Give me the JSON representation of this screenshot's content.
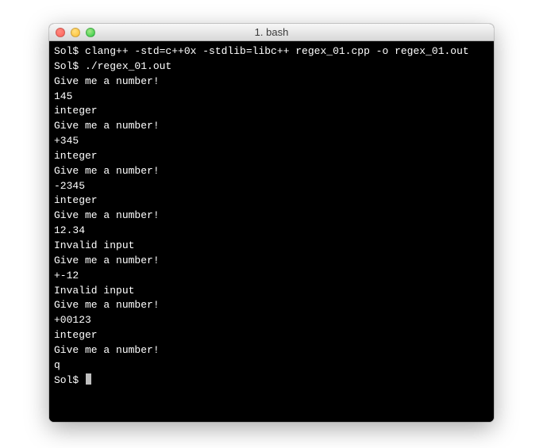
{
  "window": {
    "title": "1. bash"
  },
  "prompt": "Sol$ ",
  "lines": [
    {
      "type": "cmd",
      "text": "clang++ -std=c++0x -stdlib=libc++ regex_01.cpp -o regex_01.out"
    },
    {
      "type": "cmd",
      "text": "./regex_01.out"
    },
    {
      "type": "out",
      "text": "Give me a number!"
    },
    {
      "type": "out",
      "text": "145"
    },
    {
      "type": "out",
      "text": "integer"
    },
    {
      "type": "out",
      "text": "Give me a number!"
    },
    {
      "type": "out",
      "text": "+345"
    },
    {
      "type": "out",
      "text": "integer"
    },
    {
      "type": "out",
      "text": "Give me a number!"
    },
    {
      "type": "out",
      "text": "-2345"
    },
    {
      "type": "out",
      "text": "integer"
    },
    {
      "type": "out",
      "text": "Give me a number!"
    },
    {
      "type": "out",
      "text": "12.34"
    },
    {
      "type": "out",
      "text": "Invalid input"
    },
    {
      "type": "out",
      "text": "Give me a number!"
    },
    {
      "type": "out",
      "text": "+-12"
    },
    {
      "type": "out",
      "text": "Invalid input"
    },
    {
      "type": "out",
      "text": "Give me a number!"
    },
    {
      "type": "out",
      "text": "+00123"
    },
    {
      "type": "out",
      "text": "integer"
    },
    {
      "type": "out",
      "text": "Give me a number!"
    },
    {
      "type": "out",
      "text": "q"
    },
    {
      "type": "prompt_cursor"
    }
  ]
}
